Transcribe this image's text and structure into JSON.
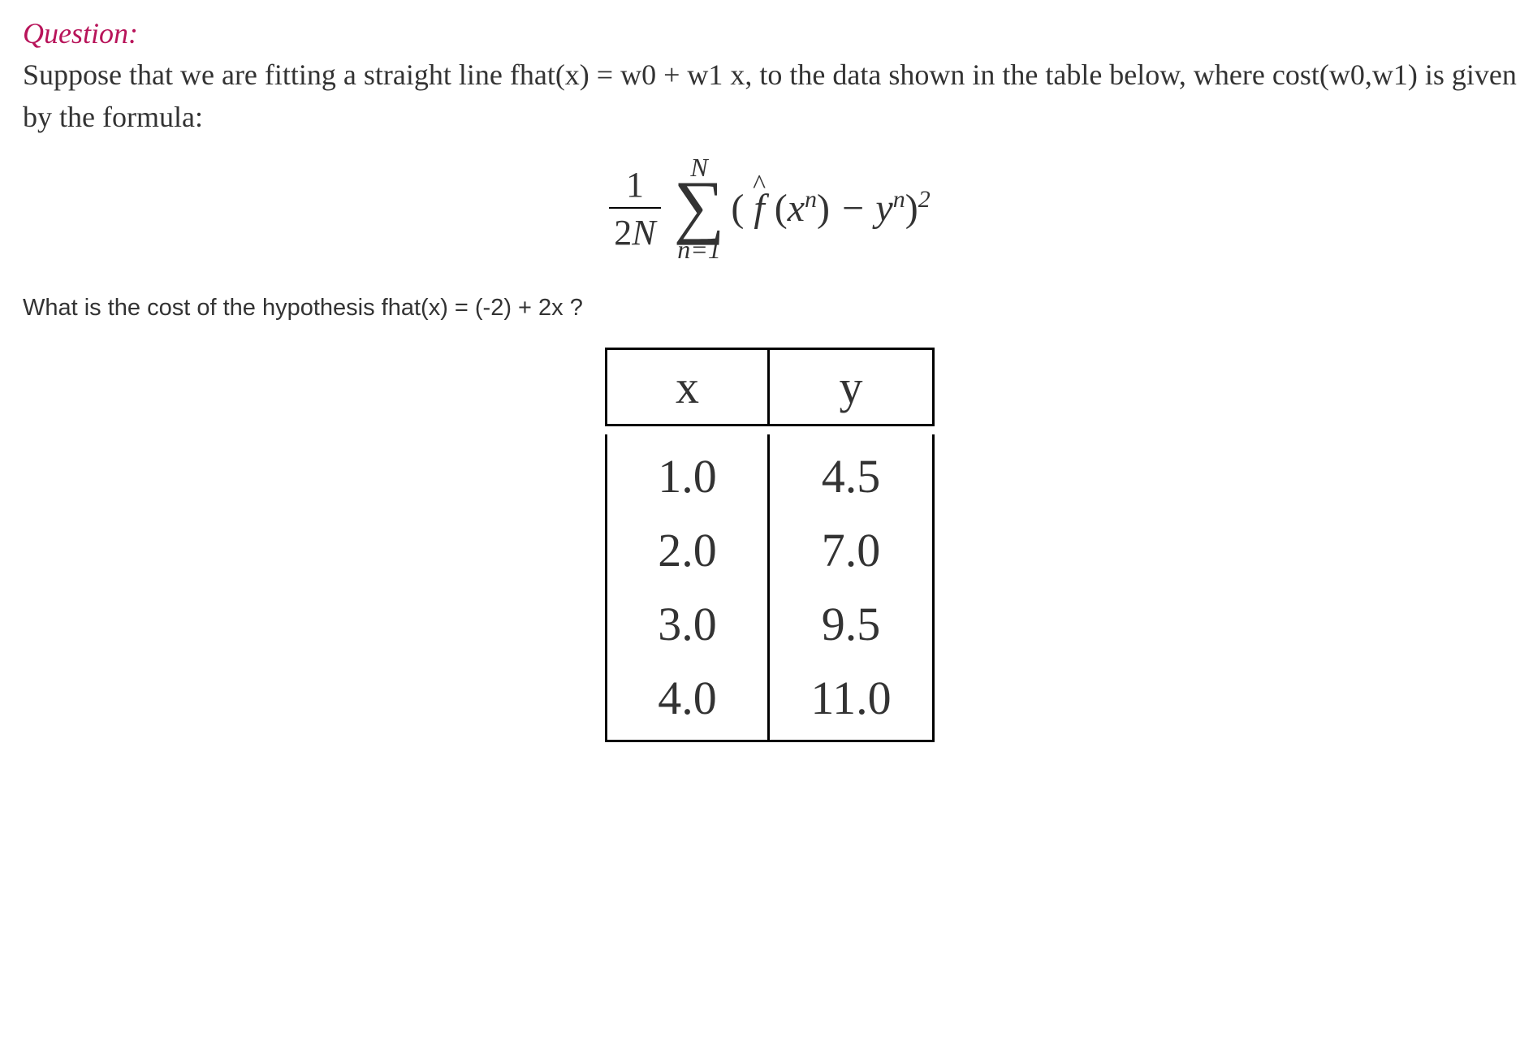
{
  "question_label": "Question:",
  "question_text": "Suppose that we are fitting a straight line fhat(x) = w0 + w1 x, to the data shown in the table below, where cost(w0,w1) is given by the formula:",
  "formula": {
    "frac_num": "1",
    "frac_den_a": "2",
    "frac_den_b": "N",
    "sum_top": "N",
    "sum_bottom": "n=1",
    "fhat": "f",
    "x": "x",
    "sup_n1": "n",
    "minus": " − ",
    "y": "y",
    "sup_n2": "n",
    "sq": "2"
  },
  "sub_question": "What is the cost of the hypothesis fhat(x) = (-2) + 2x ?",
  "table": {
    "header": {
      "x": "x",
      "y": "y"
    },
    "rows": [
      {
        "x": "1.0",
        "y": "4.5"
      },
      {
        "x": "2.0",
        "y": "7.0"
      },
      {
        "x": "3.0",
        "y": "9.5"
      },
      {
        "x": "4.0",
        "y": "11.0"
      }
    ]
  },
  "chart_data": {
    "type": "table",
    "columns": [
      "x",
      "y"
    ],
    "rows": [
      [
        1.0,
        4.5
      ],
      [
        2.0,
        7.0
      ],
      [
        3.0,
        9.5
      ],
      [
        4.0,
        11.0
      ]
    ]
  }
}
